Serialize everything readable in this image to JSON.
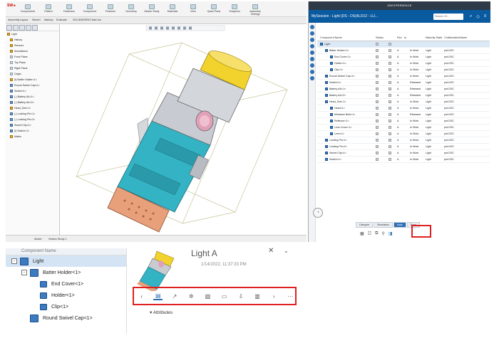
{
  "cad": {
    "ribbon_items": [
      "Components",
      "Pattern",
      "Fasteners",
      "Component",
      "Features",
      "Geometry",
      "Motion Study",
      "Materials",
      "View",
      "Quick Parts",
      "Snapshot",
      "Assembly Settings"
    ],
    "ribbon_tabs": [
      "Assembly",
      "Layout",
      "Sketch",
      "Markup",
      "Evaluate",
      "SOLIDWORKS Add-Ins"
    ],
    "tree": [
      {
        "label": "Light",
        "icon": "assembly"
      },
      {
        "label": "History",
        "icon": "folder"
      },
      {
        "label": "Sensors",
        "icon": "folder"
      },
      {
        "label": "Annotations",
        "icon": "folder"
      },
      {
        "label": "Front Plane",
        "icon": "plane"
      },
      {
        "label": "Top Plane",
        "icon": "plane"
      },
      {
        "label": "Right Plane",
        "icon": "plane"
      },
      {
        "label": "Origin",
        "icon": "plane"
      },
      {
        "label": "(f) Batter Holder<1>",
        "icon": "assembly"
      },
      {
        "label": "Round Swivel Cap<1>",
        "icon": "part"
      },
      {
        "label": "Switch<1>",
        "icon": "part"
      },
      {
        "label": "(-) Battery AA<1>",
        "icon": "part"
      },
      {
        "label": "(-) Battery AA<2>",
        "icon": "part"
      },
      {
        "label": "Head_Sub<1>",
        "icon": "assembly"
      },
      {
        "label": "(-) Locking Pin<1>",
        "icon": "part"
      },
      {
        "label": "(-) Locking Pin<2>",
        "icon": "part"
      },
      {
        "label": "Swivel Clip<1>",
        "icon": "part"
      },
      {
        "label": "(f) Switch<1>",
        "icon": "part"
      },
      {
        "label": "Mates",
        "icon": "folder"
      }
    ],
    "bottom_tabs": [
      "Model",
      "Motion Study 1"
    ]
  },
  "pane": {
    "header": "3DEXPERIENCE",
    "session": "MySession - Light (DS - DS(ALD12 - LU...",
    "search_placeholder": "Search Of...",
    "columns": [
      "Component Name",
      "Status",
      "",
      "Rev",
      "Is",
      "",
      "Maturity State",
      "Collaborative",
      "Name"
    ],
    "rows": [
      {
        "name": "Light",
        "indent": 0,
        "rev": "",
        "state": "",
        "space": "",
        "nm": ""
      },
      {
        "name": "Batter Holder<1>",
        "indent": 1,
        "rev": "A",
        "state": "In Work",
        "space": "Light",
        "nm": "prd-DSC"
      },
      {
        "name": "End Cover<1>",
        "indent": 2,
        "rev": "A",
        "state": "In Work",
        "space": "Light",
        "nm": "prd-DSC"
      },
      {
        "name": "Holder<1>",
        "indent": 2,
        "rev": "A",
        "state": "In Work",
        "space": "Light",
        "nm": "prd-DSC"
      },
      {
        "name": "Clip<1>",
        "indent": 2,
        "rev": "A",
        "state": "In Work",
        "space": "Light",
        "nm": "prd-DSC"
      },
      {
        "name": "Round Swivel Cap<1>",
        "indent": 1,
        "rev": "A",
        "state": "In Work",
        "space": "Light",
        "nm": "prd-DSC"
      },
      {
        "name": "Switch<1>",
        "indent": 1,
        "rev": "A",
        "state": "Released",
        "space": "Light",
        "nm": "prd-DSC"
      },
      {
        "name": "Battery AA<1>",
        "indent": 1,
        "rev": "A",
        "state": "Released",
        "space": "Light",
        "nm": "prd-DSC"
      },
      {
        "name": "Battery AA<2>",
        "indent": 1,
        "rev": "A",
        "state": "Released",
        "space": "Light",
        "nm": "prd-DSC"
      },
      {
        "name": "Head_Sub<1>",
        "indent": 1,
        "rev": "A",
        "state": "In Work",
        "space": "Light",
        "nm": "prd-DSC"
      },
      {
        "name": "Head<1>",
        "indent": 2,
        "rev": "A",
        "state": "In Work",
        "space": "Light",
        "nm": "prd-DSC"
      },
      {
        "name": "Miniature Bulb<1>",
        "indent": 2,
        "rev": "A",
        "state": "Released",
        "space": "Light",
        "nm": "prd-DSC"
      },
      {
        "name": "Reflector<1>",
        "indent": 2,
        "rev": "A",
        "state": "In Work",
        "space": "Light",
        "nm": "prd-DSC"
      },
      {
        "name": "Lens Cover<1>",
        "indent": 2,
        "rev": "A",
        "state": "In Work",
        "space": "Light",
        "nm": "prd-DSC"
      },
      {
        "name": "Lens<1>",
        "indent": 2,
        "rev": "A",
        "state": "In Work",
        "space": "Light",
        "nm": "prd-DSC"
      },
      {
        "name": "Locking Pin<1>",
        "indent": 1,
        "rev": "A",
        "state": "In Work",
        "space": "Light",
        "nm": "prd-DSC"
      },
      {
        "name": "Locking Pin<2>",
        "indent": 1,
        "rev": "A",
        "state": "In Work",
        "space": "Light",
        "nm": "prd-DSC"
      },
      {
        "name": "Swivel Clip<1>",
        "indent": 1,
        "rev": "A",
        "state": "In Work",
        "space": "Light",
        "nm": "prd-DSC"
      },
      {
        "name": "Switch<1>",
        "indent": 1,
        "rev": "A",
        "state": "In Work",
        "space": "Light",
        "nm": "prd-DSC"
      }
    ],
    "tabs": [
      "Lifecycle",
      "Simulation",
      "Mate",
      "Docs"
    ]
  },
  "zoom": {
    "column_header": "Component Name",
    "rows": [
      {
        "label": "Light",
        "indent": 0,
        "expander": "-",
        "selected": true
      },
      {
        "label": "Batter Holder<1>",
        "indent": 1,
        "expander": "-",
        "selected": false
      },
      {
        "label": "End Cover<1>",
        "indent": 2,
        "expander": "",
        "selected": false
      },
      {
        "label": "Holder<1>",
        "indent": 2,
        "expander": "",
        "selected": false
      },
      {
        "label": "Clip<1>",
        "indent": 2,
        "expander": "",
        "selected": false
      },
      {
        "label": "Round Swivel Cap<1>",
        "indent": 1,
        "expander": "",
        "selected": false
      }
    ],
    "card_title": "Light A",
    "card_date": "1/14/2022, 11:37:33 PM",
    "attributes_label": "Attributes"
  },
  "colors": {
    "accent": "#0a5aa0",
    "highlight": "#e02020",
    "body": "#33b3c4",
    "cap": "#f2d22c",
    "base": "#e8a07a"
  }
}
